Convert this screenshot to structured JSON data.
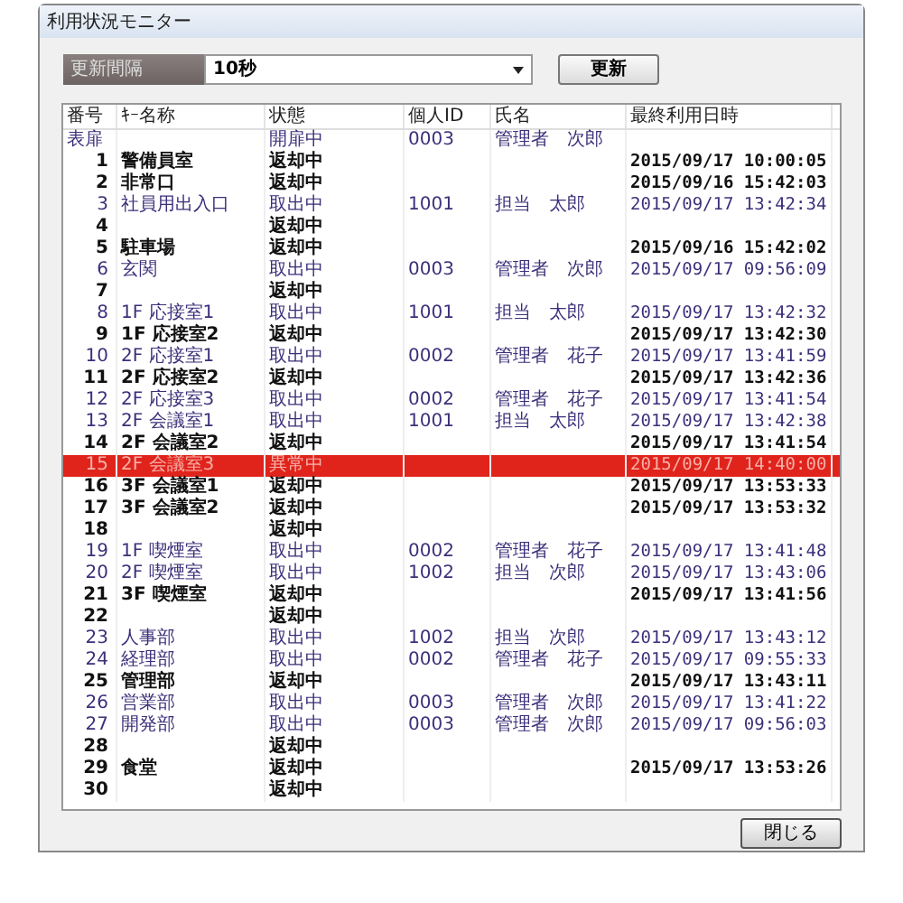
{
  "window": {
    "title": "利用状況モニター"
  },
  "interval": {
    "label": "更新間隔",
    "value": "10秒"
  },
  "refresh_button": "更新",
  "table": {
    "columns": [
      "番号",
      "ｷｰ名称",
      "状態",
      "個人ID",
      "氏名",
      "最終利用日時"
    ],
    "rows": [
      {
        "kind": "out",
        "cells": [
          "表扉",
          "",
          "開扉中",
          "0003",
          "管理者　次郎",
          ""
        ]
      },
      {
        "kind": "returned",
        "cells": [
          "1",
          "警備員室",
          "返却中",
          "",
          "",
          "2015/09/17 10:00:05"
        ]
      },
      {
        "kind": "returned",
        "cells": [
          "2",
          "非常口",
          "返却中",
          "",
          "",
          "2015/09/16 15:42:03"
        ]
      },
      {
        "kind": "out",
        "cells": [
          "3",
          "社員用出入口",
          "取出中",
          "1001",
          "担当　太郎",
          "2015/09/17 13:42:34"
        ]
      },
      {
        "kind": "returned",
        "cells": [
          "4",
          "",
          "返却中",
          "",
          "",
          ""
        ]
      },
      {
        "kind": "returned",
        "cells": [
          "5",
          "駐車場",
          "返却中",
          "",
          "",
          "2015/09/16 15:42:02"
        ]
      },
      {
        "kind": "out",
        "cells": [
          "6",
          "玄関",
          "取出中",
          "0003",
          "管理者　次郎",
          "2015/09/17 09:56:09"
        ]
      },
      {
        "kind": "returned",
        "cells": [
          "7",
          "",
          "返却中",
          "",
          "",
          ""
        ]
      },
      {
        "kind": "out",
        "cells": [
          "8",
          "1F 応接室1",
          "取出中",
          "1001",
          "担当　太郎",
          "2015/09/17 13:42:32"
        ]
      },
      {
        "kind": "returned",
        "cells": [
          "9",
          "1F 応接室2",
          "返却中",
          "",
          "",
          "2015/09/17 13:42:30"
        ]
      },
      {
        "kind": "out",
        "cells": [
          "10",
          "2F 応接室1",
          "取出中",
          "0002",
          "管理者　花子",
          "2015/09/17 13:41:59"
        ]
      },
      {
        "kind": "returned",
        "cells": [
          "11",
          "2F 応接室2",
          "返却中",
          "",
          "",
          "2015/09/17 13:42:36"
        ]
      },
      {
        "kind": "out",
        "cells": [
          "12",
          "2F 応接室3",
          "取出中",
          "0002",
          "管理者　花子",
          "2015/09/17 13:41:54"
        ]
      },
      {
        "kind": "out",
        "cells": [
          "13",
          "2F 会議室1",
          "取出中",
          "1001",
          "担当　太郎",
          "2015/09/17 13:42:38"
        ]
      },
      {
        "kind": "returned",
        "cells": [
          "14",
          "2F 会議室2",
          "返却中",
          "",
          "",
          "2015/09/17 13:41:54"
        ]
      },
      {
        "kind": "alert",
        "cells": [
          "15",
          "2F 会議室3",
          "異常中",
          "",
          "",
          "2015/09/17 14:40:00"
        ]
      },
      {
        "kind": "returned",
        "cells": [
          "16",
          "3F 会議室1",
          "返却中",
          "",
          "",
          "2015/09/17 13:53:33"
        ]
      },
      {
        "kind": "returned",
        "cells": [
          "17",
          "3F 会議室2",
          "返却中",
          "",
          "",
          "2015/09/17 13:53:32"
        ]
      },
      {
        "kind": "returned",
        "cells": [
          "18",
          "",
          "返却中",
          "",
          "",
          ""
        ]
      },
      {
        "kind": "out",
        "cells": [
          "19",
          "1F 喫煙室",
          "取出中",
          "0002",
          "管理者　花子",
          "2015/09/17 13:41:48"
        ]
      },
      {
        "kind": "out",
        "cells": [
          "20",
          "2F 喫煙室",
          "取出中",
          "1002",
          "担当　次郎",
          "2015/09/17 13:43:06"
        ]
      },
      {
        "kind": "returned",
        "cells": [
          "21",
          "3F 喫煙室",
          "返却中",
          "",
          "",
          "2015/09/17 13:41:56"
        ]
      },
      {
        "kind": "returned",
        "cells": [
          "22",
          "",
          "返却中",
          "",
          "",
          ""
        ]
      },
      {
        "kind": "out",
        "cells": [
          "23",
          "人事部",
          "取出中",
          "1002",
          "担当　次郎",
          "2015/09/17 13:43:12"
        ]
      },
      {
        "kind": "out",
        "cells": [
          "24",
          "経理部",
          "取出中",
          "0002",
          "管理者　花子",
          "2015/09/17 09:55:33"
        ]
      },
      {
        "kind": "returned",
        "cells": [
          "25",
          "管理部",
          "返却中",
          "",
          "",
          "2015/09/17 13:43:11"
        ]
      },
      {
        "kind": "out",
        "cells": [
          "26",
          "営業部",
          "取出中",
          "0003",
          "管理者　次郎",
          "2015/09/17 13:41:22"
        ]
      },
      {
        "kind": "out",
        "cells": [
          "27",
          "開発部",
          "取出中",
          "0003",
          "管理者　次郎",
          "2015/09/17 09:56:03"
        ]
      },
      {
        "kind": "returned",
        "cells": [
          "28",
          "",
          "返却中",
          "",
          "",
          ""
        ]
      },
      {
        "kind": "returned",
        "cells": [
          "29",
          "食堂",
          "返却中",
          "",
          "",
          "2015/09/17 13:53:26"
        ]
      },
      {
        "kind": "returned",
        "cells": [
          "30",
          "",
          "返却中",
          "",
          "",
          ""
        ]
      }
    ]
  },
  "close_button": "閉じる"
}
